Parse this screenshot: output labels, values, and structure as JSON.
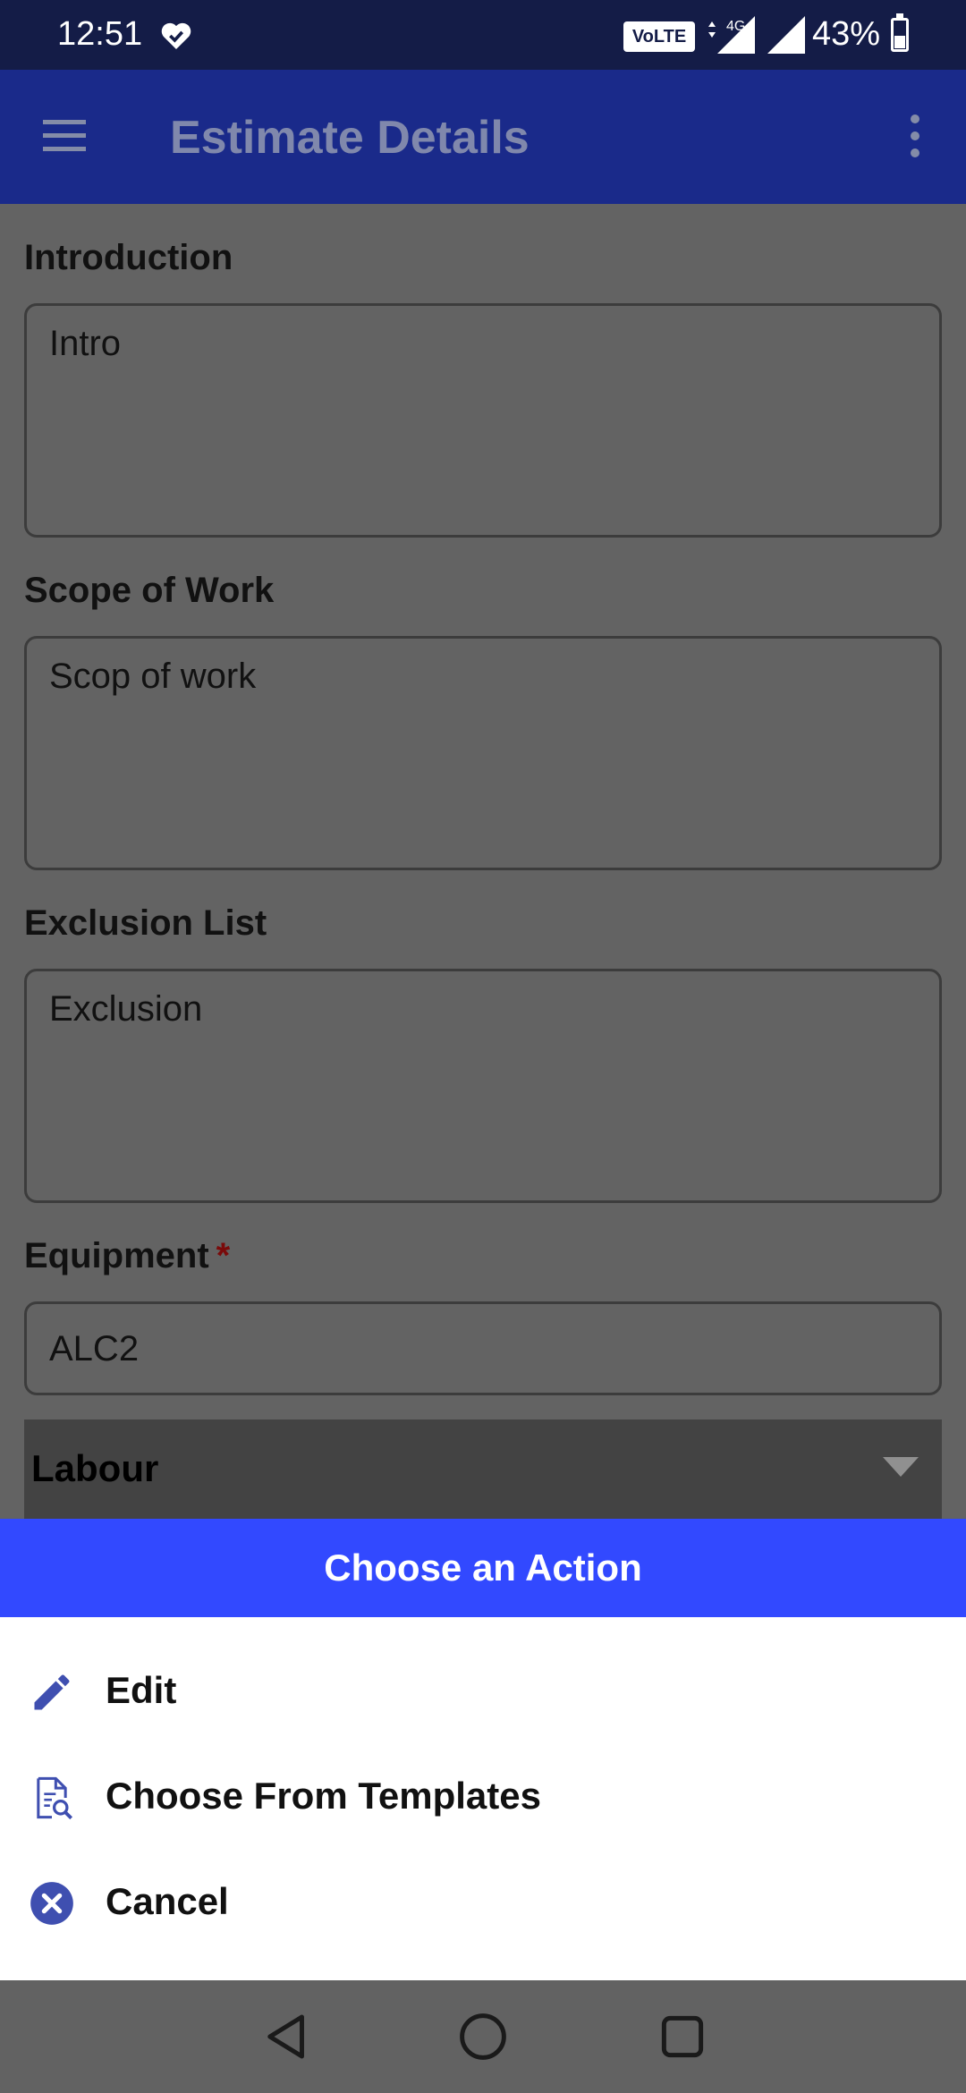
{
  "status_bar": {
    "time": "12:51",
    "volte": "VoLTE",
    "network": "4G",
    "battery_percent": "43%",
    "battery_level": 0.43
  },
  "app_bar": {
    "title": "Estimate Details",
    "menu_icon": "hamburger-menu-icon",
    "overflow_icon": "more-vert-icon"
  },
  "form": {
    "introduction": {
      "label": "Introduction",
      "value": "Intro"
    },
    "scope_of_work": {
      "label": "Scope of Work",
      "value": "Scop of work"
    },
    "exclusion_list": {
      "label": "Exclusion List",
      "value": "Exclusion"
    },
    "equipment": {
      "label": "Equipment",
      "required_mark": "*",
      "value": "ALC2"
    },
    "labour": {
      "label": "Labour"
    }
  },
  "action_sheet": {
    "title": "Choose an Action",
    "items": [
      {
        "label": "Edit",
        "icon": "pencil-icon"
      },
      {
        "label": "Choose From Templates",
        "icon": "document-search-icon"
      },
      {
        "label": "Cancel",
        "icon": "cancel-circle-icon"
      }
    ]
  },
  "colors": {
    "status_bar": "#141c47",
    "app_bar": "#1a2a8a",
    "accent": "#3249ff",
    "icon": "#3f4fb0",
    "overlay": "#636363"
  }
}
